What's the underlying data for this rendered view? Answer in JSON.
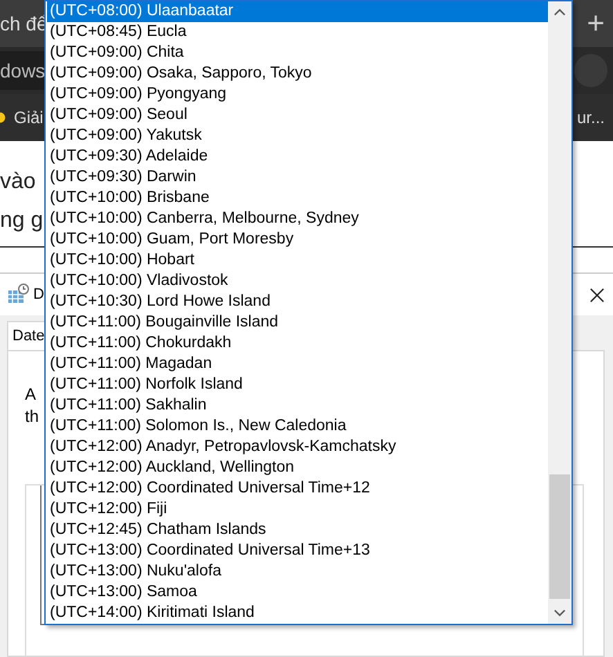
{
  "browser": {
    "tab_text": "ch để",
    "new_tab": "+",
    "address_text": "dows",
    "bookmark": "Giải",
    "bookmark_right": "ur..."
  },
  "page": {
    "lines": [
      "vào",
      "ng g"
    ]
  },
  "dialog": {
    "title": "D",
    "tabs": [
      {
        "label": "Date",
        "selected": true
      }
    ],
    "text_lines": [
      "A",
      "th"
    ]
  },
  "timezone_list": {
    "items": [
      {
        "label": "(UTC+08:00) Ulaanbaatar",
        "selected": true
      },
      {
        "label": "(UTC+08:45) Eucla",
        "selected": false
      },
      {
        "label": "(UTC+09:00) Chita",
        "selected": false
      },
      {
        "label": "(UTC+09:00) Osaka, Sapporo, Tokyo",
        "selected": false
      },
      {
        "label": "(UTC+09:00) Pyongyang",
        "selected": false
      },
      {
        "label": "(UTC+09:00) Seoul",
        "selected": false
      },
      {
        "label": "(UTC+09:00) Yakutsk",
        "selected": false
      },
      {
        "label": "(UTC+09:30) Adelaide",
        "selected": false
      },
      {
        "label": "(UTC+09:30) Darwin",
        "selected": false
      },
      {
        "label": "(UTC+10:00) Brisbane",
        "selected": false
      },
      {
        "label": "(UTC+10:00) Canberra, Melbourne, Sydney",
        "selected": false
      },
      {
        "label": "(UTC+10:00) Guam, Port Moresby",
        "selected": false
      },
      {
        "label": "(UTC+10:00) Hobart",
        "selected": false
      },
      {
        "label": "(UTC+10:00) Vladivostok",
        "selected": false
      },
      {
        "label": "(UTC+10:30) Lord Howe Island",
        "selected": false
      },
      {
        "label": "(UTC+11:00) Bougainville Island",
        "selected": false
      },
      {
        "label": "(UTC+11:00) Chokurdakh",
        "selected": false
      },
      {
        "label": "(UTC+11:00) Magadan",
        "selected": false
      },
      {
        "label": "(UTC+11:00) Norfolk Island",
        "selected": false
      },
      {
        "label": "(UTC+11:00) Sakhalin",
        "selected": false
      },
      {
        "label": "(UTC+11:00) Solomon Is., New Caledonia",
        "selected": false
      },
      {
        "label": "(UTC+12:00) Anadyr, Petropavlovsk-Kamchatsky",
        "selected": false
      },
      {
        "label": "(UTC+12:00) Auckland, Wellington",
        "selected": false
      },
      {
        "label": "(UTC+12:00) Coordinated Universal Time+12",
        "selected": false
      },
      {
        "label": "(UTC+12:00) Fiji",
        "selected": false
      },
      {
        "label": "(UTC+12:45) Chatham Islands",
        "selected": false
      },
      {
        "label": "(UTC+13:00) Coordinated Universal Time+13",
        "selected": false
      },
      {
        "label": "(UTC+13:00) Nuku'alofa",
        "selected": false
      },
      {
        "label": "(UTC+13:00) Samoa",
        "selected": false
      },
      {
        "label": "(UTC+14:00) Kiritimati Island",
        "selected": false
      }
    ]
  }
}
